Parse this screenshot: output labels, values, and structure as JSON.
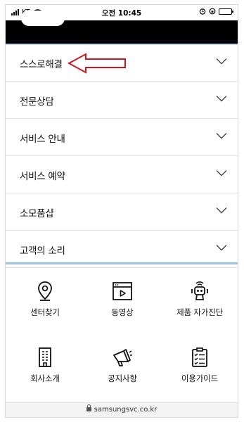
{
  "status_bar": {
    "carrier": "KT",
    "time": "오전 10:45"
  },
  "menu": {
    "items": [
      {
        "label": "스스로해결"
      },
      {
        "label": "전문상담"
      },
      {
        "label": "서비스 안내"
      },
      {
        "label": "서비스 예약"
      },
      {
        "label": "소모품샵"
      },
      {
        "label": "고객의 소리"
      }
    ]
  },
  "annotation": {
    "arrow_color": "#d0161c"
  },
  "quick_links": {
    "items": [
      {
        "label": "센터찾기",
        "icon": "location-pin-icon"
      },
      {
        "label": "동영상",
        "icon": "video-player-icon"
      },
      {
        "label": "제품 자가진단",
        "icon": "robot-diagnosis-icon"
      },
      {
        "label": "회사소개",
        "icon": "building-icon"
      },
      {
        "label": "공지사항",
        "icon": "megaphone-icon"
      },
      {
        "label": "이용가이드",
        "icon": "checklist-icon"
      }
    ]
  },
  "browser": {
    "url": "samsungsvc.co.kr"
  },
  "colors": {
    "header_band": "#000000",
    "accent_line": "#1e3f78",
    "section_divider": "#9cc2e8"
  }
}
